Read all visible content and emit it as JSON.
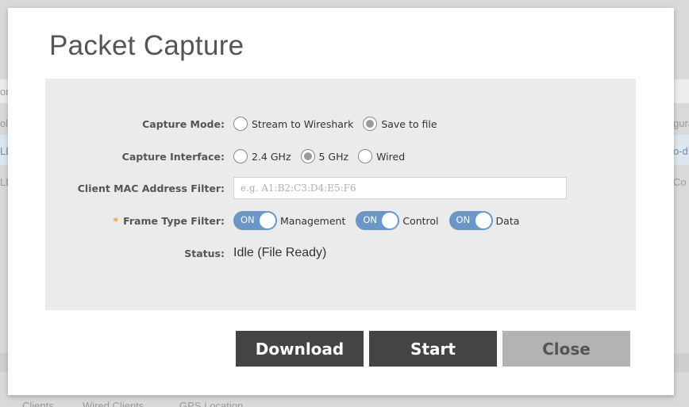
{
  "background": {
    "left_fragments": [
      "or",
      "ol",
      "LL",
      "LL"
    ],
    "right_fragments": [
      "gura",
      "o-d",
      "Co"
    ],
    "bottom_tabs": [
      "Clients",
      "Wired Clients",
      "GPS Location"
    ]
  },
  "modal": {
    "title": "Packet Capture",
    "capture_mode": {
      "label": "Capture Mode:",
      "options": [
        {
          "label": "Stream to Wireshark",
          "checked": false
        },
        {
          "label": "Save to file",
          "checked": true
        }
      ]
    },
    "capture_interface": {
      "label": "Capture Interface:",
      "options": [
        {
          "label": "2.4 GHz",
          "checked": false
        },
        {
          "label": "5 GHz",
          "checked": true
        },
        {
          "label": "Wired",
          "checked": false
        }
      ]
    },
    "client_mac": {
      "label": "Client MAC Address Filter:",
      "value": "",
      "placeholder": "e.g. A1:B2:C3:D4:E5:F6"
    },
    "frame_type": {
      "required_mark": "*",
      "label": "Frame Type Filter:",
      "toggles": [
        {
          "state": "ON",
          "label": "Management"
        },
        {
          "state": "ON",
          "label": "Control"
        },
        {
          "state": "ON",
          "label": "Data"
        }
      ]
    },
    "status": {
      "label": "Status:",
      "value": "Idle (File Ready)"
    },
    "buttons": {
      "download": "Download",
      "start": "Start",
      "close": "Close"
    }
  }
}
